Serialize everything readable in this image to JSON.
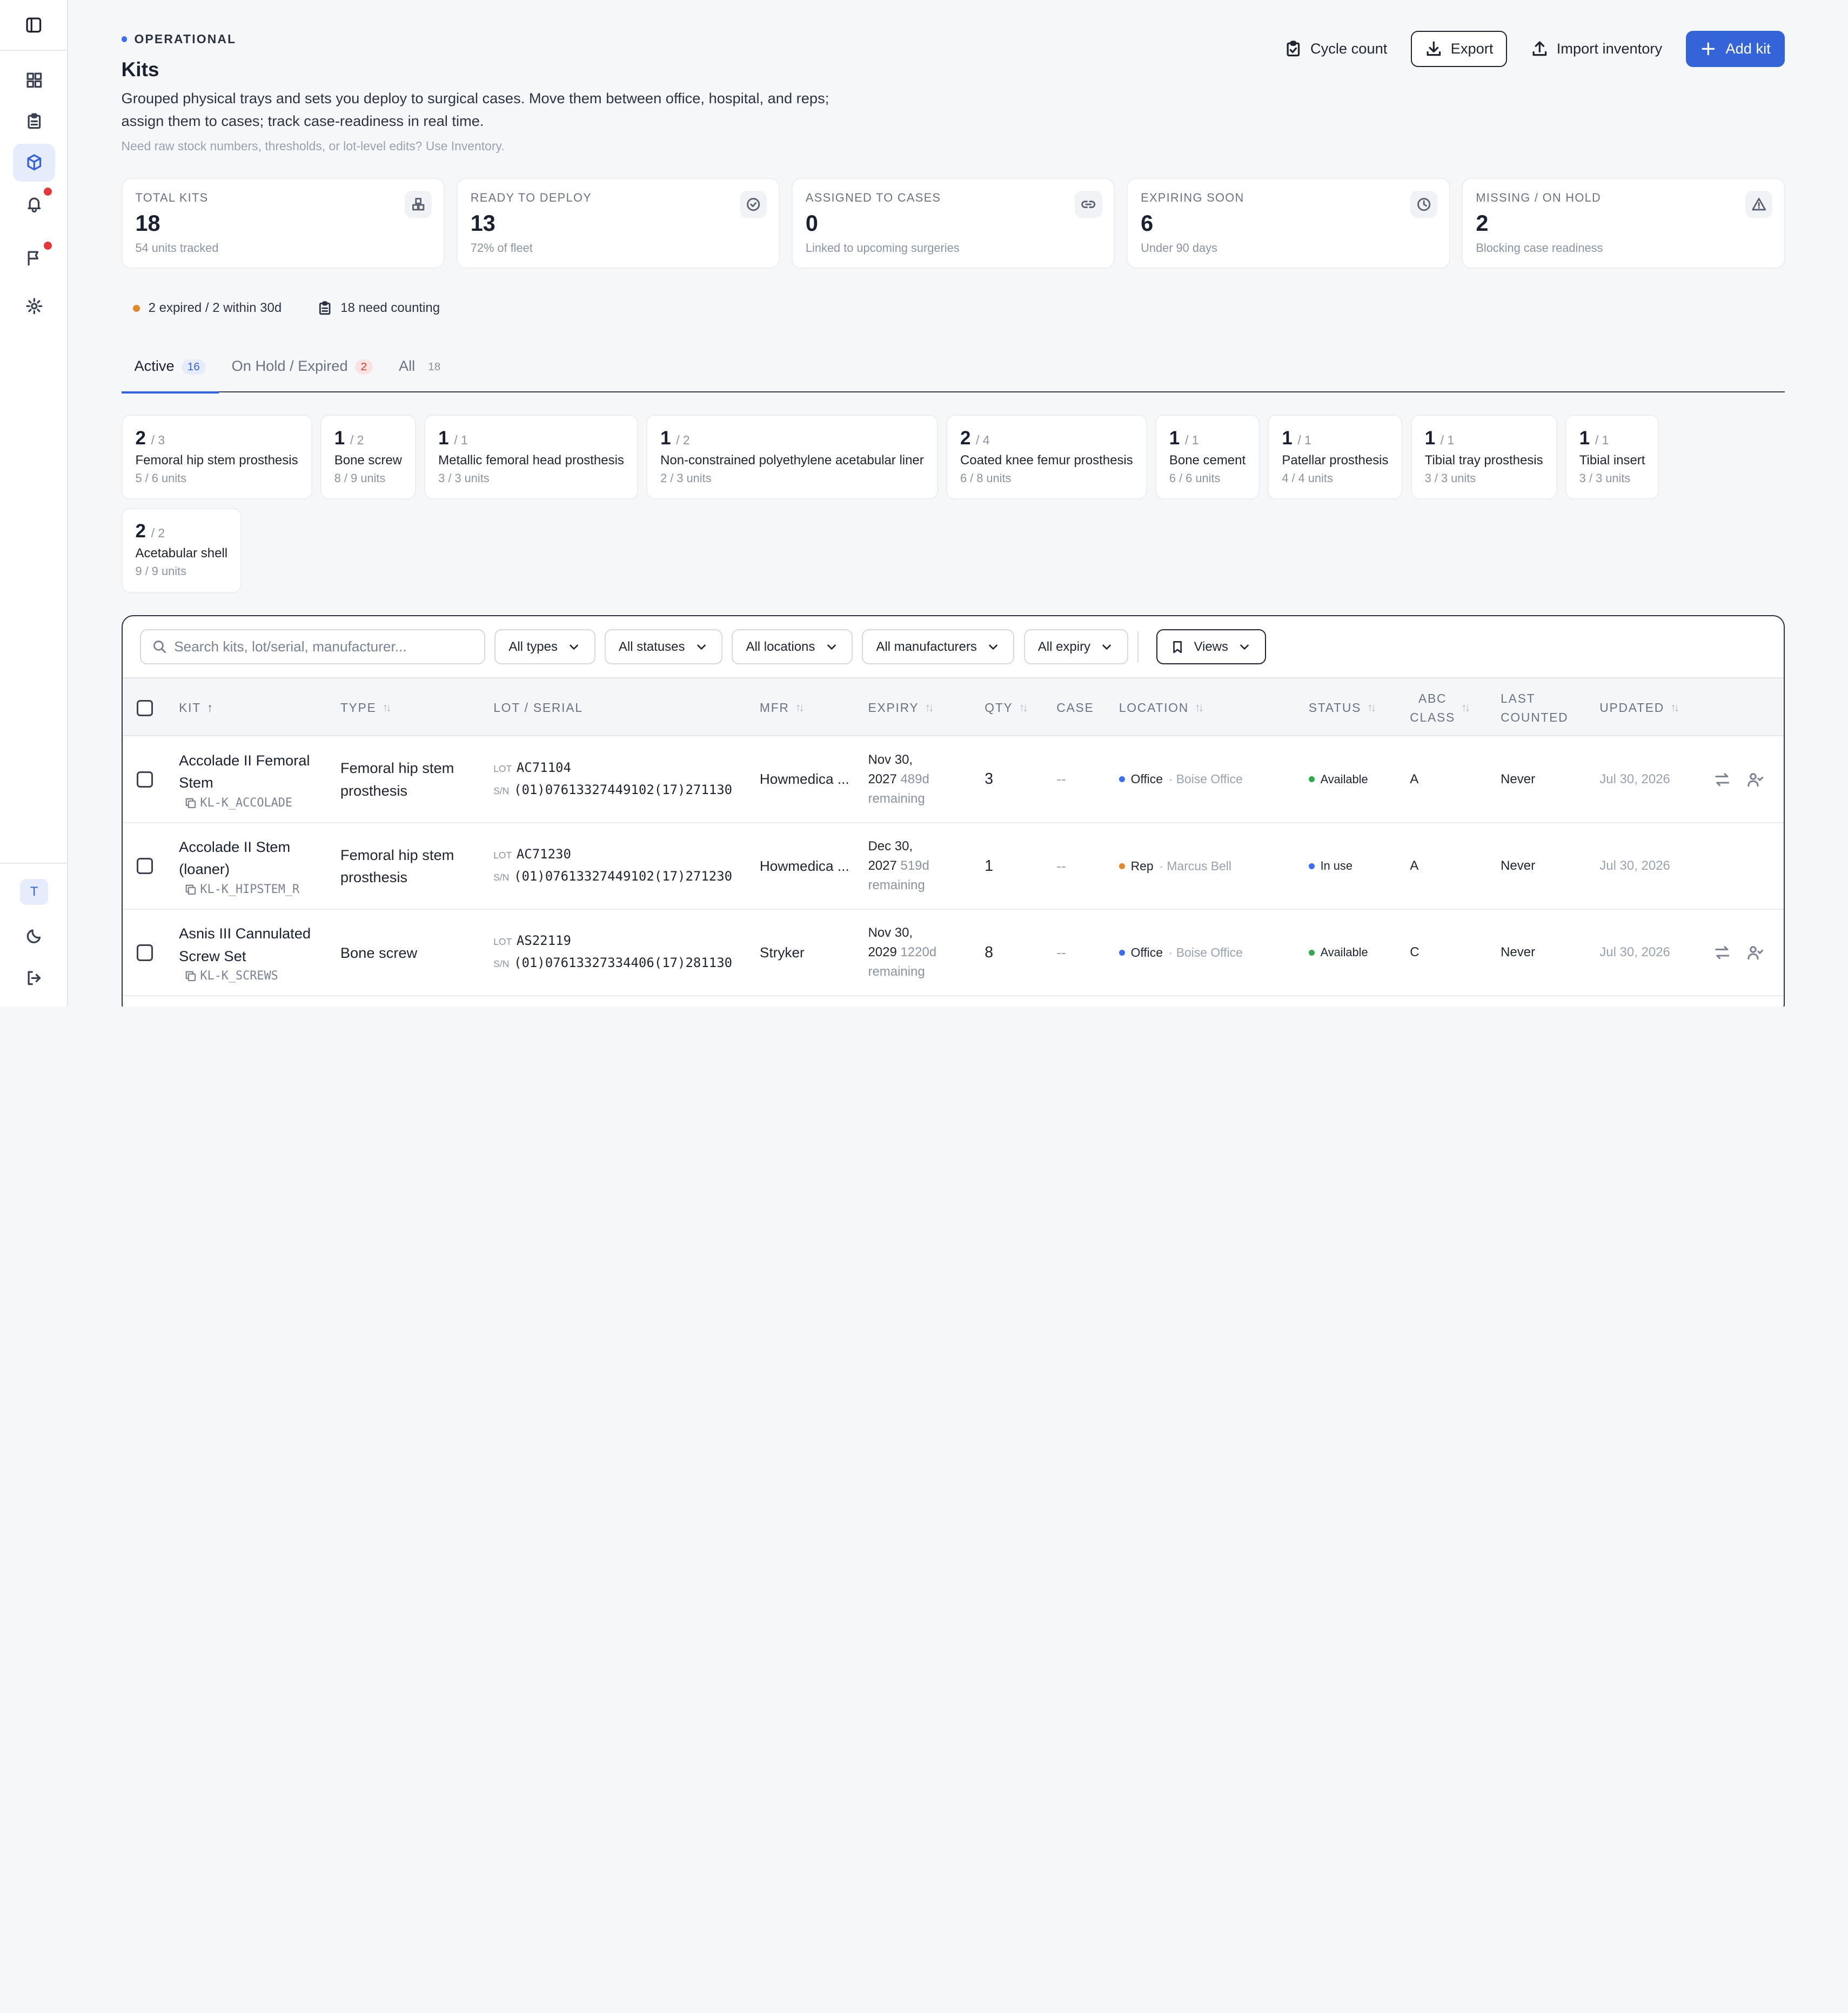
{
  "header": {
    "eyebrow": "OPERATIONAL",
    "title": "Kits",
    "description": "Grouped physical trays and sets you deploy to surgical cases. Move them between office, hospital, and reps; assign them to cases; track case-readiness in real time.",
    "hint": "Need raw stock numbers, thresholds, or lot-level edits? Use Inventory."
  },
  "actions": {
    "cycle_count": "Cycle count",
    "export": "Export",
    "import": "Import inventory",
    "add": "Add kit"
  },
  "stats": [
    {
      "label": "TOTAL KITS",
      "value": "18",
      "sub": "54 units tracked",
      "icon": "cubes-icon"
    },
    {
      "label": "READY TO DEPLOY",
      "value": "13",
      "sub": "72% of fleet",
      "icon": "check-circle-icon"
    },
    {
      "label": "ASSIGNED TO CASES",
      "value": "0",
      "sub": "Linked to upcoming surgeries",
      "icon": "link-icon"
    },
    {
      "label": "EXPIRING SOON",
      "value": "6",
      "sub": "Under 90 days",
      "icon": "clock-icon"
    },
    {
      "label": "MISSING / ON HOLD",
      "value": "2",
      "sub": "Blocking case readiness",
      "icon": "alert-triangle-icon"
    }
  ],
  "alerts": {
    "expired": "2 expired / 2 within 30d",
    "counting": "18 need counting"
  },
  "tabs": [
    {
      "label": "Active",
      "count": "16"
    },
    {
      "label": "On Hold / Expired",
      "count": "2"
    },
    {
      "label": "All",
      "count": "18"
    }
  ],
  "types": [
    {
      "count": "2",
      "total": "/ 3",
      "name": "Femoral hip stem prosthesis",
      "units": "5 / 6 units"
    },
    {
      "count": "1",
      "total": "/ 2",
      "name": "Bone screw",
      "units": "8 / 9 units"
    },
    {
      "count": "1",
      "total": "/ 1",
      "name": "Metallic femoral head prosthesis",
      "units": "3 / 3 units"
    },
    {
      "count": "1",
      "total": "/ 2",
      "name": "Non-constrained polyethylene acetabular liner",
      "units": "2 / 3 units"
    },
    {
      "count": "2",
      "total": "/ 4",
      "name": "Coated knee femur prosthesis",
      "units": "6 / 8 units"
    },
    {
      "count": "1",
      "total": "/ 1",
      "name": "Bone cement",
      "units": "6 / 6 units"
    },
    {
      "count": "1",
      "total": "/ 1",
      "name": "Patellar prosthesis",
      "units": "4 / 4 units"
    },
    {
      "count": "1",
      "total": "/ 1",
      "name": "Tibial tray prosthesis",
      "units": "3 / 3 units"
    },
    {
      "count": "1",
      "total": "/ 1",
      "name": "Tibial insert",
      "units": "3 / 3 units"
    },
    {
      "count": "2",
      "total": "/ 2",
      "name": "Acetabular shell",
      "units": "9 / 9 units"
    }
  ],
  "filters": {
    "search_placeholder": "Search kits, lot/serial, manufacturer...",
    "types": "All types",
    "statuses": "All statuses",
    "locations": "All locations",
    "manufacturers": "All manufacturers",
    "expiry": "All expiry",
    "views": "Views"
  },
  "columns": {
    "kit": "KIT",
    "type": "TYPE",
    "lot": "LOT / SERIAL",
    "mfr": "MFR",
    "expiry": "EXPIRY",
    "qty": "QTY",
    "case": "CASE",
    "location": "LOCATION",
    "status": "STATUS",
    "abc1": "ABC",
    "abc2": "CLASS",
    "last1": "LAST",
    "last2": "COUNTED",
    "updated": "UPDATED"
  },
  "rows": [
    {
      "name1": "Accolade II Femoral",
      "name2": "Stem",
      "code": "KL-K_ACCOLADE",
      "type1": "Femoral hip stem",
      "type2": "prosthesis",
      "lot": "AC71104",
      "sn": "(01)07613327449102(17)271130",
      "mfr": "Howmedica ...",
      "exp1": "Nov 30,",
      "exp2a": "2027",
      "exp2b": "489d",
      "exp3": "remaining",
      "qty": "3",
      "case": "--",
      "loc_type": "Office",
      "loc_name": "· Boise Office",
      "loc_color": "#3b6ef0",
      "status": "Available",
      "status_color": "#2fa84f",
      "abc": "A",
      "counted": "Never",
      "updated": "Jul 30, 2026",
      "icons": true
    },
    {
      "name1": "Accolade II Stem",
      "name2": "(loaner)",
      "code": "KL-K_HIPSTEM_R",
      "type1": "Femoral hip stem",
      "type2": "prosthesis",
      "lot": "AC71230",
      "sn": "(01)07613327449102(17)271230",
      "mfr": "Howmedica ...",
      "exp1": "Dec 30,",
      "exp2a": "2027",
      "exp2b": "519d",
      "exp3": "remaining",
      "qty": "1",
      "case": "--",
      "loc_type": "Rep",
      "loc_name": "· Marcus Bell",
      "loc_color": "#e0892a",
      "status": "In use",
      "status_color": "#3b6ef0",
      "abc": "A",
      "counted": "Never",
      "updated": "Jul 30, 2026",
      "icons": false
    },
    {
      "name1": "Asnis III Cannulated",
      "name2": "Screw Set",
      "code": "KL-K_SCREWS",
      "type1": "Bone screw",
      "type2": "",
      "lot": "AS22119",
      "sn": "(01)07613327334406(17)281130",
      "mfr": "Stryker",
      "exp1": "Nov 30,",
      "exp2a": "2029",
      "exp2b": "1220d",
      "exp3": "remaining",
      "qty": "8",
      "case": "--",
      "loc_type": "Office",
      "loc_name": "· Boise Office",
      "loc_color": "#3b6ef0",
      "status": "Available",
      "status_color": "#2fa84f",
      "abc": "C",
      "counted": "Never",
      "updated": "Jul 30, 2026",
      "icons": true
    }
  ],
  "user": {
    "initial": "T"
  }
}
